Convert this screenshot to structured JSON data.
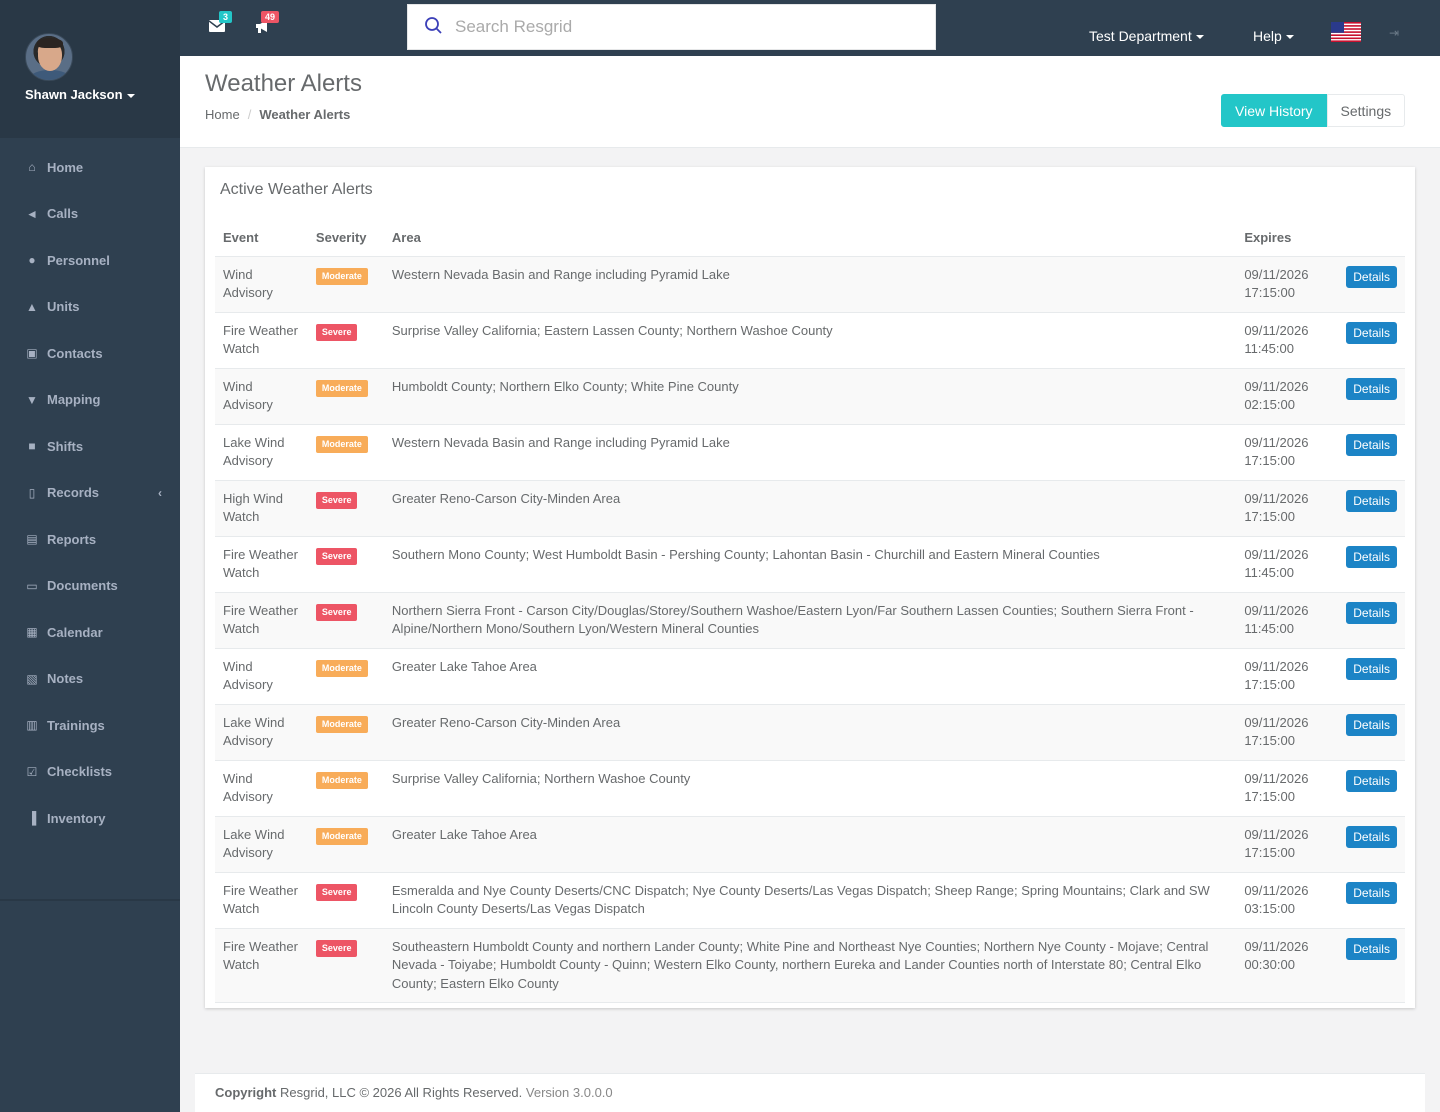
{
  "user": {
    "name": "Shawn Jackson"
  },
  "sidebar": {
    "items": [
      {
        "label": "Home",
        "icon": "home-icon"
      },
      {
        "label": "Calls",
        "icon": "bullhorn-icon"
      },
      {
        "label": "Personnel",
        "icon": "user-icon"
      },
      {
        "label": "Units",
        "icon": "truck-icon"
      },
      {
        "label": "Contacts",
        "icon": "contact-book-icon"
      },
      {
        "label": "Mapping",
        "icon": "map-marker-icon"
      },
      {
        "label": "Shifts",
        "icon": "briefcase-icon"
      },
      {
        "label": "Records",
        "icon": "file-icon"
      },
      {
        "label": "Reports",
        "icon": "copy-icon"
      },
      {
        "label": "Documents",
        "icon": "document-icon"
      },
      {
        "label": "Calendar",
        "icon": "calendar-icon"
      },
      {
        "label": "Notes",
        "icon": "notes-icon"
      },
      {
        "label": "Trainings",
        "icon": "book-icon"
      },
      {
        "label": "Checklists",
        "icon": "checklist-icon"
      },
      {
        "label": "Inventory",
        "icon": "barcode-icon"
      }
    ]
  },
  "topbar": {
    "messages_count": "3",
    "calls_count": "49",
    "search_placeholder": "Search Resgrid",
    "department": "Test Department",
    "help": "Help",
    "colors": {
      "bar": "#2f4050",
      "messages_badge": "#23c6c8",
      "calls_badge": "#ed5565"
    }
  },
  "page": {
    "title": "Weather Alerts",
    "breadcrumb_home": "Home",
    "breadcrumb_current": "Weather Alerts",
    "btn_history": "View History",
    "btn_settings": "Settings"
  },
  "panel": {
    "title": "Active Weather Alerts",
    "columns": {
      "event": "Event",
      "severity": "Severity",
      "area": "Area",
      "expires": "Expires"
    },
    "details_label": "Details",
    "rows": [
      {
        "event": "Wind Advisory",
        "severity": "Moderate",
        "area": "Western Nevada Basin and Range including Pyramid Lake",
        "expires_date": "09/11/2026",
        "expires_time": "17:15:00"
      },
      {
        "event": "Fire Weather Watch",
        "severity": "Severe",
        "area": "Surprise Valley California; Eastern Lassen County; Northern Washoe County",
        "expires_date": "09/11/2026",
        "expires_time": "11:45:00"
      },
      {
        "event": "Wind Advisory",
        "severity": "Moderate",
        "area": "Humboldt County; Northern Elko County; White Pine County",
        "expires_date": "09/11/2026",
        "expires_time": "02:15:00"
      },
      {
        "event": "Lake Wind Advisory",
        "severity": "Moderate",
        "area": "Western Nevada Basin and Range including Pyramid Lake",
        "expires_date": "09/11/2026",
        "expires_time": "17:15:00"
      },
      {
        "event": "High Wind Watch",
        "severity": "Severe",
        "area": "Greater Reno-Carson City-Minden Area",
        "expires_date": "09/11/2026",
        "expires_time": "17:15:00"
      },
      {
        "event": "Fire Weather Watch",
        "severity": "Severe",
        "area": "Southern Mono County; West Humboldt Basin - Pershing County; Lahontan Basin - Churchill and Eastern Mineral Counties",
        "expires_date": "09/11/2026",
        "expires_time": "11:45:00"
      },
      {
        "event": "Fire Weather Watch",
        "severity": "Severe",
        "area": "Northern Sierra Front - Carson City/Douglas/Storey/Southern Washoe/Eastern Lyon/Far Southern Lassen Counties; Southern Sierra Front - Alpine/Northern Mono/Southern Lyon/Western Mineral Counties",
        "expires_date": "09/11/2026",
        "expires_time": "11:45:00"
      },
      {
        "event": "Wind Advisory",
        "severity": "Moderate",
        "area": "Greater Lake Tahoe Area",
        "expires_date": "09/11/2026",
        "expires_time": "17:15:00"
      },
      {
        "event": "Lake Wind Advisory",
        "severity": "Moderate",
        "area": "Greater Reno-Carson City-Minden Area",
        "expires_date": "09/11/2026",
        "expires_time": "17:15:00"
      },
      {
        "event": "Wind Advisory",
        "severity": "Moderate",
        "area": "Surprise Valley California; Northern Washoe County",
        "expires_date": "09/11/2026",
        "expires_time": "17:15:00"
      },
      {
        "event": "Lake Wind Advisory",
        "severity": "Moderate",
        "area": "Greater Lake Tahoe Area",
        "expires_date": "09/11/2026",
        "expires_time": "17:15:00"
      },
      {
        "event": "Fire Weather Watch",
        "severity": "Severe",
        "area": "Esmeralda and Nye County Deserts/CNC Dispatch; Nye County Deserts/Las Vegas Dispatch; Sheep Range; Spring Mountains; Clark and SW Lincoln County Deserts/Las Vegas Dispatch",
        "expires_date": "09/11/2026",
        "expires_time": "03:15:00"
      },
      {
        "event": "Fire Weather Watch",
        "severity": "Severe",
        "area": "Southeastern Humboldt County and northern Lander County; White Pine and Northeast Nye Counties; Northern Nye County - Mojave; Central Nevada - Toiyabe; Humboldt County - Quinn; Western Elko County, northern Eureka and Lander Counties north of Interstate 80; Central Elko County; Eastern Elko County",
        "expires_date": "09/11/2026",
        "expires_time": "00:30:00"
      }
    ]
  },
  "footer": {
    "copyright_label": "Copyright",
    "copyright_text": "Resgrid, LLC © 2026 All Rights Reserved.",
    "version": "Version 3.0.0.0"
  }
}
